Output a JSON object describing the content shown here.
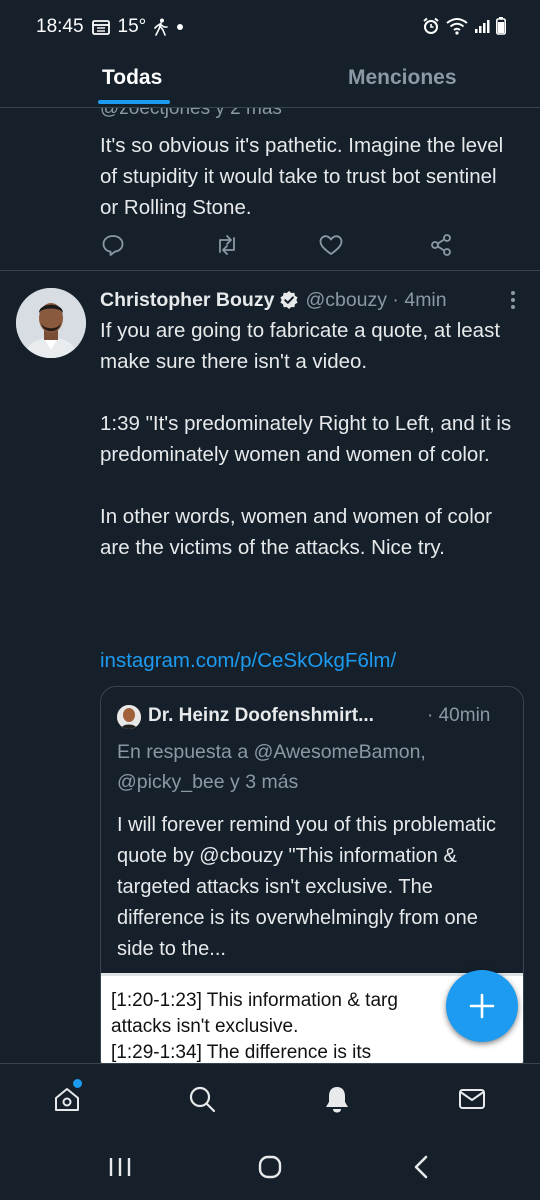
{
  "status_bar": {
    "time": "18:45",
    "temperature": "15°",
    "icons": [
      "calendar-icon",
      "walking-icon",
      "dot-icon",
      "alarm-icon",
      "wifi-icon",
      "signal-icon",
      "battery-icon"
    ]
  },
  "tabs": [
    {
      "label": "Todas",
      "active": true
    },
    {
      "label": "Menciones",
      "active": false
    }
  ],
  "previous_tweet": {
    "reply_context": "@zoectjones y 2 más",
    "text": "It's so obvious it's pathetic. Imagine the level of stupidity it would take to trust bot sentinel or Rolling Stone."
  },
  "tweet": {
    "author_name": "Christopher Bouzy",
    "handle_time": "@cbouzy · 4min",
    "verified": true,
    "text": "If you are going to fabricate a quote, at least make sure there isn't a video.\n\n1:39 \"It's predominately Right to Left, and it is predominately women and women of color.\n\nIn other words, women and women of color are the victims of the attacks. Nice try.",
    "link": "instagram.com/p/CeSkOkgF6lm/",
    "quote": {
      "author_name": "Dr. Heinz Doofenshmirt...",
      "time": "· 40min",
      "reply_to": "En respuesta a @AwesomeBamon,\n@picky_bee y 3 más",
      "text": "I will forever remind you of this problematic quote by @cbouzy \"This information & targeted attacks isn't exclusive. The difference is its overwhelmingly from one side to the...",
      "image_text": "[1:20-1:23] This information & targ\nattacks isn't exclusive.\n[1:29-1:34] The difference is its"
    }
  },
  "bottom_nav": [
    "home-icon",
    "search-icon",
    "notifications-icon",
    "messages-icon"
  ],
  "system_nav": [
    "recents-icon",
    "home-circle-icon",
    "back-icon"
  ],
  "colors": {
    "background": "#15202b",
    "accent": "#1d9bf0",
    "secondary_text": "#8b98a5",
    "divider": "#38444d"
  }
}
